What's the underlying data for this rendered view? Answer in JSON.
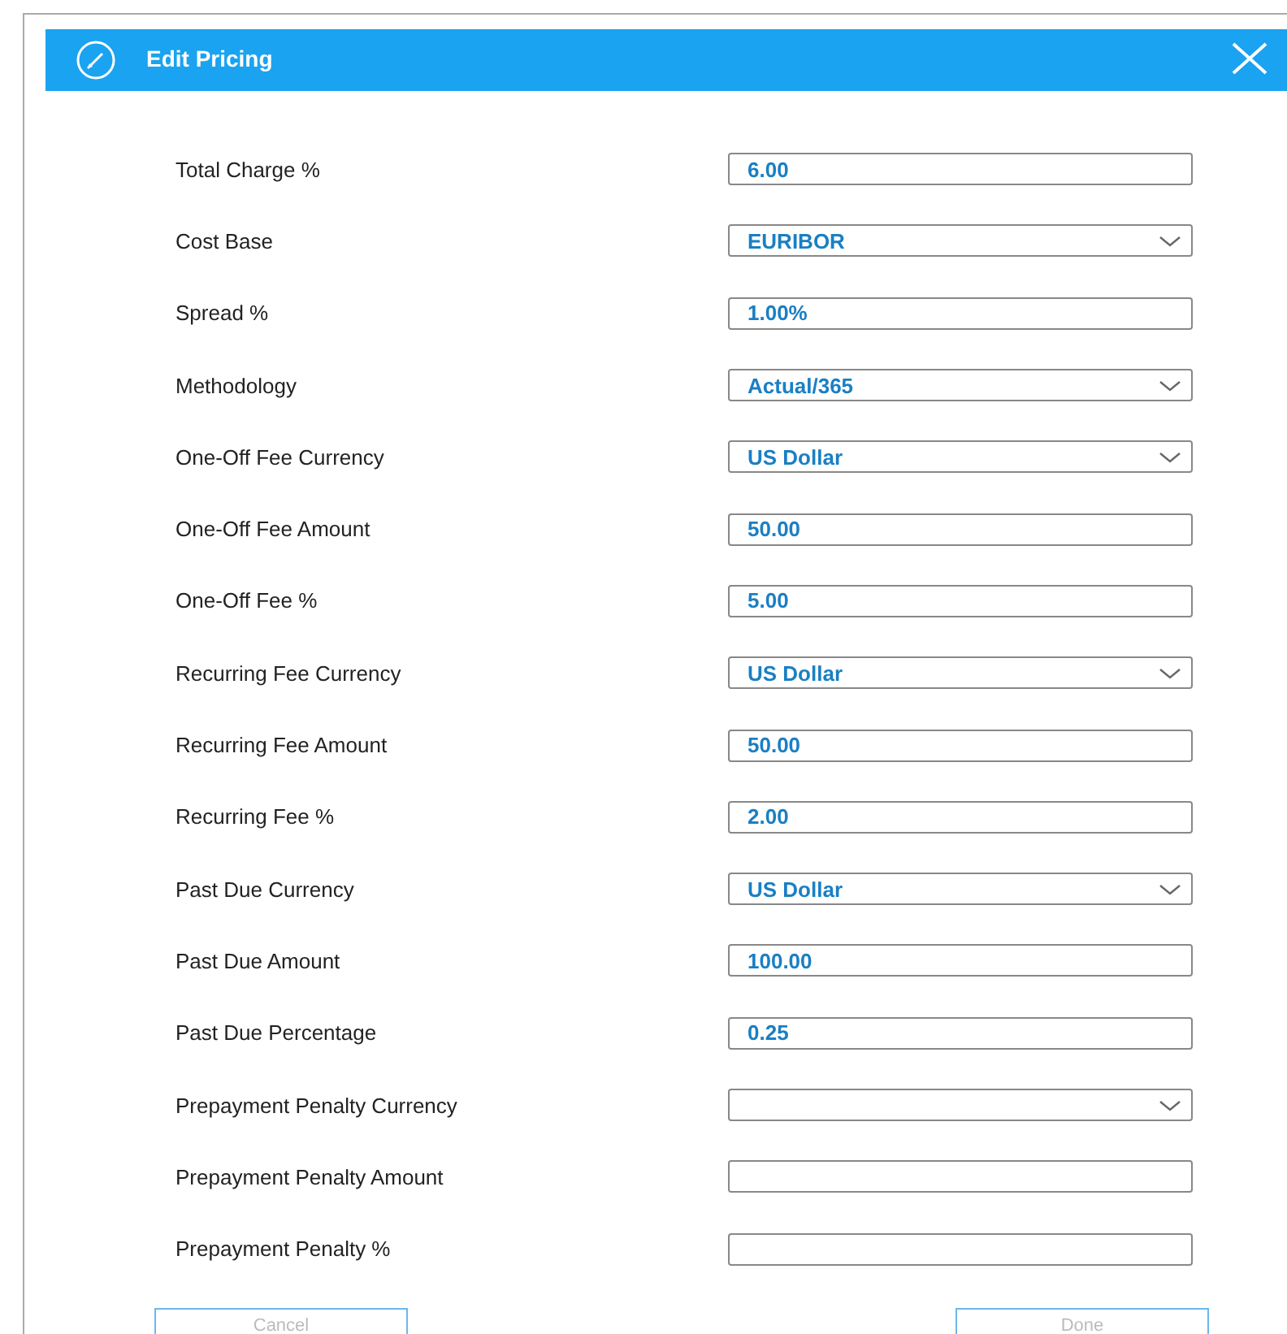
{
  "dialog": {
    "title": "Edit Pricing"
  },
  "fields": [
    {
      "label": "Total Charge %",
      "kind": "text",
      "value": "6.00"
    },
    {
      "label": "Cost Base",
      "kind": "select",
      "value": "EURIBOR"
    },
    {
      "label": "Spread %",
      "kind": "text",
      "value": "1.00%"
    },
    {
      "label": "Methodology",
      "kind": "select",
      "value": "Actual/365"
    },
    {
      "label": "One-Off Fee Currency",
      "kind": "select",
      "value": "US Dollar"
    },
    {
      "label": "One-Off Fee Amount",
      "kind": "text",
      "value": "50.00"
    },
    {
      "label": "One-Off Fee %",
      "kind": "text",
      "value": "5.00"
    },
    {
      "label": "Recurring Fee Currency",
      "kind": "select",
      "value": "US Dollar"
    },
    {
      "label": "Recurring Fee Amount",
      "kind": "text",
      "value": "50.00"
    },
    {
      "label": "Recurring Fee %",
      "kind": "text",
      "value": "2.00"
    },
    {
      "label": "Past Due Currency",
      "kind": "select",
      "value": "US Dollar"
    },
    {
      "label": "Past Due Amount",
      "kind": "text",
      "value": "100.00"
    },
    {
      "label": "Past Due Percentage",
      "kind": "text",
      "value": "0.25"
    },
    {
      "label": "Prepayment Penalty Currency",
      "kind": "select"
    },
    {
      "label": "Prepayment Penalty Amount",
      "kind": "text"
    },
    {
      "label": "Prepayment Penalty %",
      "kind": "text"
    }
  ],
  "buttons": [
    {
      "label": "Cancel"
    },
    {
      "label": "Done"
    }
  ]
}
